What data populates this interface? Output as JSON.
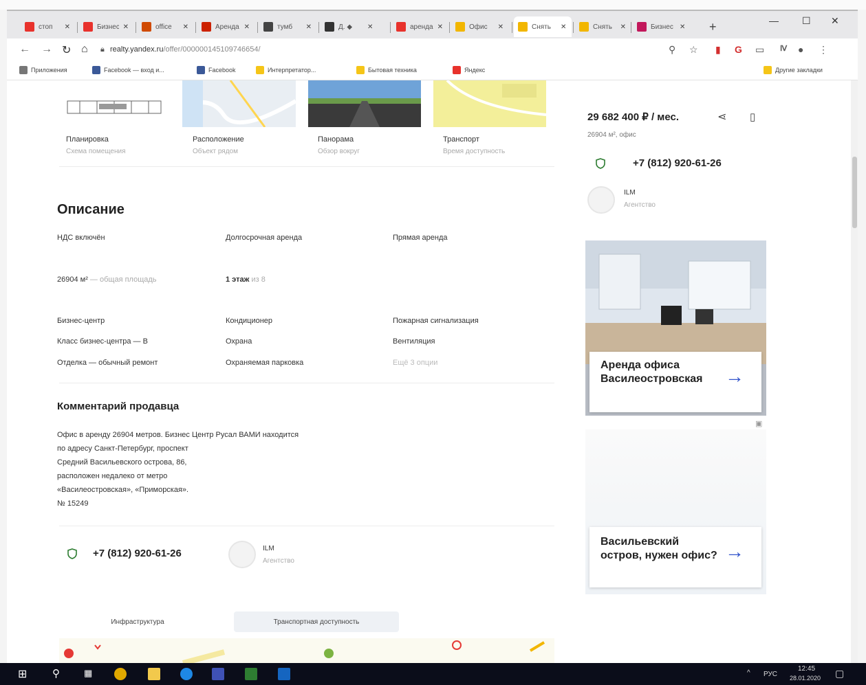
{
  "browser": {
    "tabs": [
      {
        "label": "стоп",
        "favicon": "yandex-icon",
        "color": "#e8322c"
      },
      {
        "label": "Бизнес",
        "favicon": "yandex-icon",
        "color": "#e8322c"
      },
      {
        "label": "office",
        "favicon": "office-icon",
        "color": "#d04a02"
      },
      {
        "label": "Аренда",
        "favicon": "apps-icon",
        "color": "#cc2200"
      },
      {
        "label": "тумб",
        "favicon": "globe-icon",
        "color": "#444444"
      },
      {
        "label": "Д. ◆",
        "favicon": "doc-icon",
        "color": "#333333"
      },
      {
        "label": "аренда",
        "favicon": "yandex-icon",
        "color": "#e8322c"
      },
      {
        "label": "Офис",
        "favicon": "home-icon",
        "color": "#f2b600"
      },
      {
        "label": "Снять",
        "favicon": "home-icon",
        "color": "#f2b600",
        "active": true
      },
      {
        "label": "Снять",
        "favicon": "home-icon",
        "color": "#f2b600"
      },
      {
        "label": "Бизнес",
        "favicon": "slides-icon",
        "color": "#c2185b"
      }
    ],
    "new_tab": "+",
    "url": {
      "domain": "realty.yandex.ru",
      "path": "/offer/000000145109746654/"
    },
    "bookmarks": [
      {
        "label": "Приложения",
        "color": "#777777"
      },
      {
        "label": "Facebook — вход и...",
        "color": "#3b5998"
      },
      {
        "label": "Facebook",
        "color": "#3b5998"
      },
      {
        "label": "Интерпретатор...",
        "color": "#f5c518"
      },
      {
        "label": "Бытовая техника",
        "color": "#f5c518"
      },
      {
        "label": "Яндекс",
        "color": "#e8322c"
      }
    ],
    "other_bookmarks": "Другие закладки"
  },
  "media": [
    {
      "label": "Планировка",
      "sub": "Схема помещения"
    },
    {
      "label": "Расположение",
      "sub": "Объект рядом"
    },
    {
      "label": "Панорама",
      "sub": "Обзор вокруг"
    },
    {
      "label": "Транспорт",
      "sub": "Время доступность"
    }
  ],
  "description": {
    "title": "Описание",
    "row1": [
      "НДС включён",
      "Долгосрочная аренда",
      "Прямая аренда"
    ],
    "area_value": "26904 м²",
    "area_label": " — общая площадь",
    "floor_value": "1 этаж",
    "floor_label": " из 8",
    "col1": [
      "Бизнес-центр",
      "Класс бизнес-центра — B",
      "Отделка — обычный ремонт"
    ],
    "col2": [
      "Кондиционер",
      "Охрана",
      "Охраняемая парковка"
    ],
    "col3": [
      "Пожарная сигнализация",
      "Вентиляция",
      "Ещё 3 опции"
    ]
  },
  "comment": {
    "title": "Комментарий продавца",
    "lines": [
      "Офис в аренду 26904 метров. Бизнес Центр Русал ВАМИ находится",
      "по адресу Санкт-Петербург, проспект",
      "Средний Васильевского острова, 86,",
      "расположен недалеко от метро",
      "«Василеостровская», «Приморская».",
      "№ 15249"
    ]
  },
  "contact": {
    "phone": "+7 (812) 920-61-26",
    "agent_name": "ILM",
    "agent_type": "Агентство"
  },
  "bottom_tabs": [
    "Инфраструктура",
    "Транспортная доступность"
  ],
  "sidebar": {
    "price": "29 682 400 ₽ / мес.",
    "area": "26904 м², офис",
    "phone": "+7 (812) 920-61-26",
    "agent_name": "ILM",
    "agent_type": "Агентство",
    "ads": [
      {
        "title": "Аренда офиса Василеостровская",
        "arrow": "→"
      },
      {
        "title": "Васильевский остров, нужен офис?",
        "arrow": "→"
      }
    ]
  },
  "taskbar": {
    "lang": "РУС",
    "time": "12:45",
    "date": "28.01.2020"
  },
  "colors": {
    "link_blue": "#3355cc",
    "brand_yellow": "#f2b600",
    "shield_green": "#2e7d32"
  }
}
